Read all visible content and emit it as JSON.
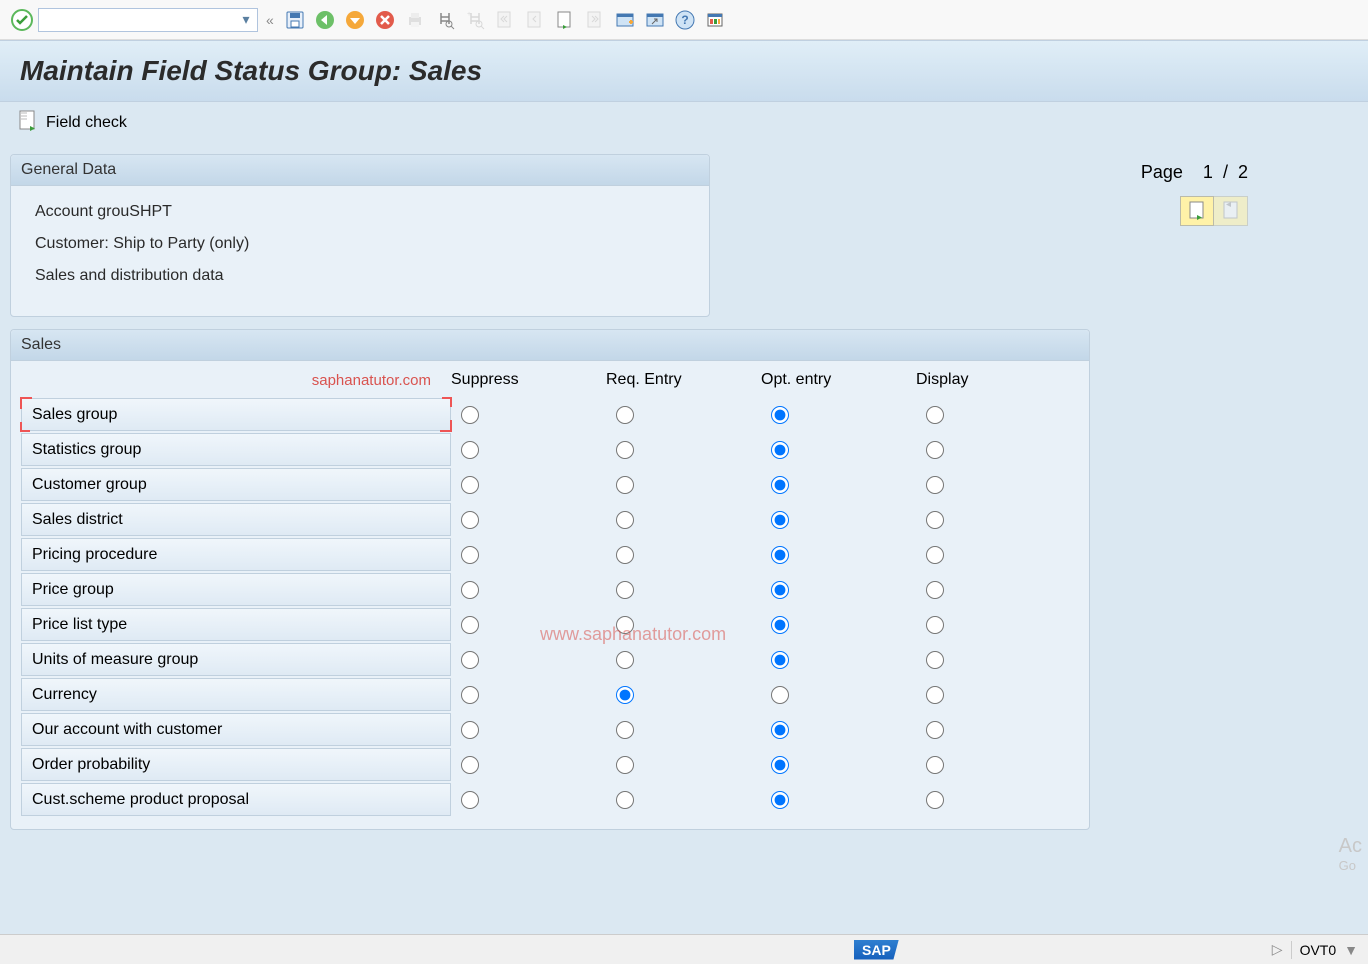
{
  "toolbar": {
    "command_value": ""
  },
  "title": "Maintain Field Status Group: Sales",
  "apptoolbar": {
    "field_check": "Field check"
  },
  "general_data": {
    "header": "General Data",
    "line1_label": "Account grou",
    "line1_value": "SHPT",
    "line2": "Customer: Ship to Party (only)",
    "line3": "Sales and distribution data"
  },
  "page_nav": {
    "label": "Page",
    "current": "1",
    "sep": "/",
    "total": "2"
  },
  "sales": {
    "header": "Sales",
    "watermark_right": "saphanatutor.com",
    "watermark_center": "www.saphanatutor.com",
    "columns": {
      "suppress": "Suppress",
      "req": "Req. Entry",
      "opt": "Opt. entry",
      "display": "Display"
    },
    "rows": [
      {
        "label": "Sales group",
        "selected": "opt",
        "focused": true
      },
      {
        "label": "Statistics group",
        "selected": "opt"
      },
      {
        "label": "Customer group",
        "selected": "opt"
      },
      {
        "label": "Sales district",
        "selected": "opt"
      },
      {
        "label": "Pricing procedure",
        "selected": "opt"
      },
      {
        "label": "Price group",
        "selected": "opt"
      },
      {
        "label": "Price list type",
        "selected": "opt"
      },
      {
        "label": "Units of measure group",
        "selected": "opt"
      },
      {
        "label": "Currency",
        "selected": "req"
      },
      {
        "label": "Our account with customer",
        "selected": "opt"
      },
      {
        "label": "Order probability",
        "selected": "opt"
      },
      {
        "label": "Cust.scheme product proposal",
        "selected": "opt"
      }
    ]
  },
  "statusbar": {
    "sap": "SAP",
    "tcode": "OVT0"
  },
  "ghost": {
    "line1": "Ac",
    "line2": "Go"
  }
}
